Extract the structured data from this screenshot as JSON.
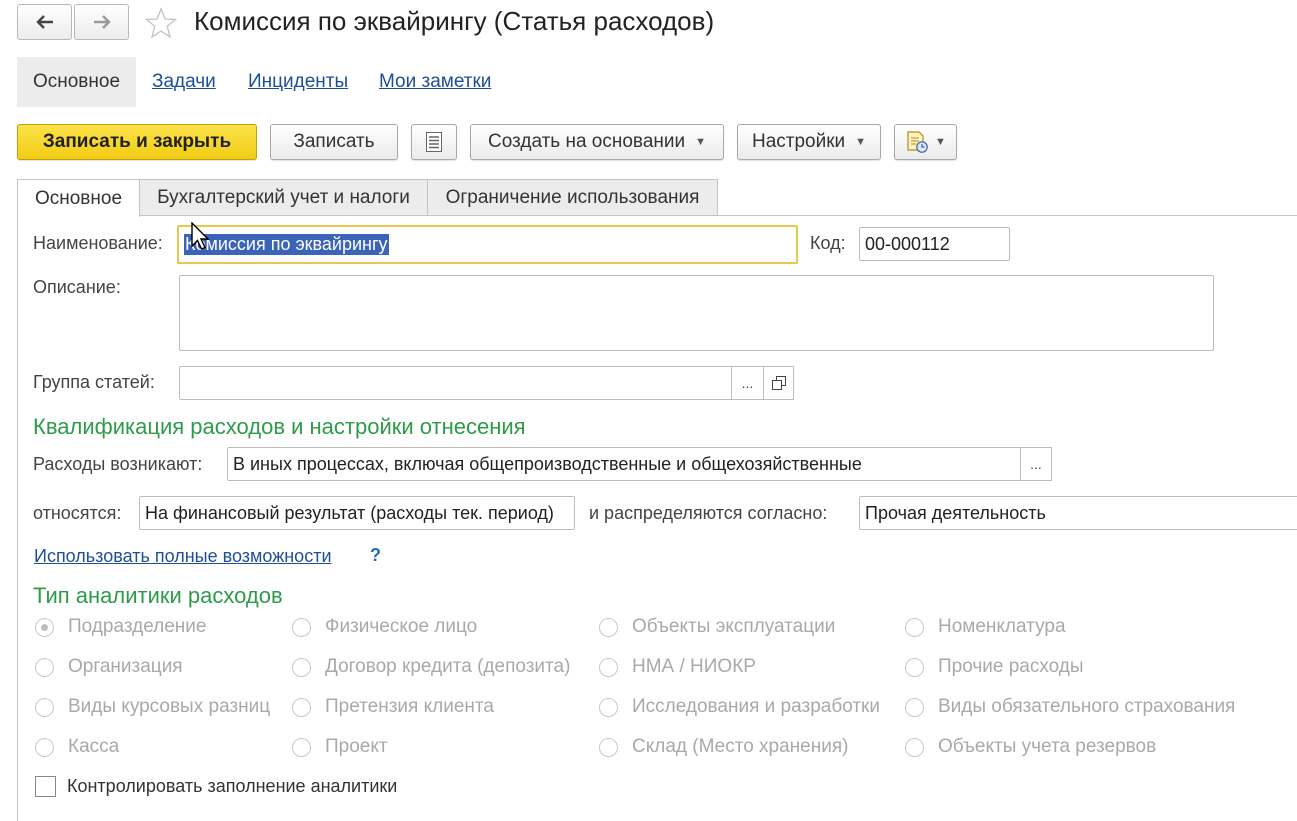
{
  "window": {
    "title": "Комиссия по эквайрингу (Статья расходов)",
    "back_icon": "arrow-left-icon",
    "forward_icon": "arrow-right-icon",
    "favorite_icon": "star-icon"
  },
  "nav_tabs": [
    {
      "label": "Основное",
      "active": true
    },
    {
      "label": "Задачи"
    },
    {
      "label": "Инциденты"
    },
    {
      "label": "Мои заметки"
    }
  ],
  "toolbar": {
    "save_close": "Записать и закрыть",
    "save": "Записать",
    "create_based": "Создать на основании",
    "settings": "Настройки"
  },
  "tabs": [
    {
      "label": "Основное",
      "active": true
    },
    {
      "label": "Бухгалтерский учет и налоги"
    },
    {
      "label": "Ограничение использования"
    }
  ],
  "form": {
    "name_label": "Наименование:",
    "name_value": "Комиссия по эквайрингу",
    "code_label": "Код:",
    "code_value": "00-000112",
    "description_label": "Описание:",
    "description_value": "",
    "group_label": "Группа статей:",
    "group_value": "",
    "group_select": "...",
    "qualification_header": "Квалификация расходов и настройки отнесения",
    "arise_label": "Расходы возникают:",
    "arise_value": "В иных процессах, включая общепроизводственные и общехозяйственные",
    "arise_select": "...",
    "relate_label": "относятся:",
    "relate_value": "На финансовый результат (расходы тек. период)",
    "distribute_label": "и распределяются согласно:",
    "distribute_value": "Прочая деятельность",
    "full_features_link": "Использовать полные возможности",
    "help_mark": "?",
    "analytics_header": "Тип аналитики расходов",
    "analytics_options": [
      {
        "label": "Подразделение",
        "selected": true
      },
      {
        "label": "Организация"
      },
      {
        "label": "Виды курсовых разниц"
      },
      {
        "label": "Касса"
      },
      {
        "label": "Физическое лицо"
      },
      {
        "label": "Договор кредита (депозита)"
      },
      {
        "label": "Претензия клиента"
      },
      {
        "label": "Проект"
      },
      {
        "label": "Объекты эксплуатации"
      },
      {
        "label": "НМА / НИОКР"
      },
      {
        "label": "Исследования и разработки"
      },
      {
        "label": "Склад (Место хранения)"
      },
      {
        "label": "Номенклатура"
      },
      {
        "label": "Прочие расходы"
      },
      {
        "label": "Виды обязательного страхования"
      },
      {
        "label": "Объекты учета резервов"
      }
    ],
    "control_checkbox_label": "Контролировать заполнение аналитики",
    "control_checked": false
  },
  "colors": {
    "primary_button": "#f2cc14",
    "section_header": "#2e9b4a",
    "link": "#1f4e98",
    "selection": "#3b63b8",
    "focus_border": "#e8c84a"
  }
}
